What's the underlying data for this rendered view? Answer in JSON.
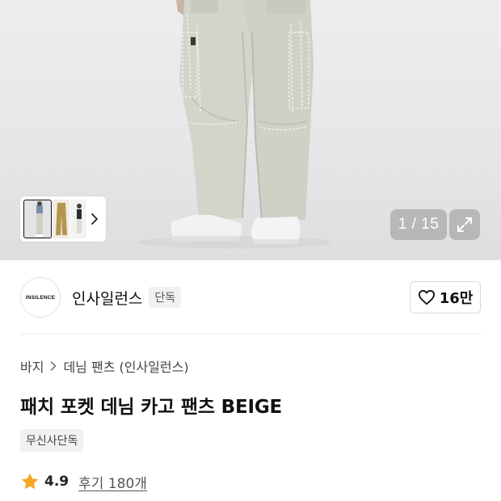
{
  "gallery": {
    "current": "1",
    "total": "15",
    "counter_text": "1 / 15",
    "thumbnails": [
      "thumb-model-front",
      "thumb-pants-flat",
      "thumb-model-side"
    ]
  },
  "brand": {
    "logo_text": "INSILENCE",
    "name": "인사일런스",
    "badge": "단독",
    "like_count": "16만"
  },
  "breadcrumb": {
    "items": [
      "바지",
      "데님 팬츠 (인사일런스)"
    ]
  },
  "product": {
    "title": "패치 포켓 데님 카고 팬츠 BEIGE",
    "tag": "무신사단독"
  },
  "rating": {
    "score": "4.9",
    "review_text": "후기 180개"
  },
  "colors": {
    "star": "#F5A623",
    "pants": "#d2d3c9",
    "background": "#e9e9eb"
  }
}
